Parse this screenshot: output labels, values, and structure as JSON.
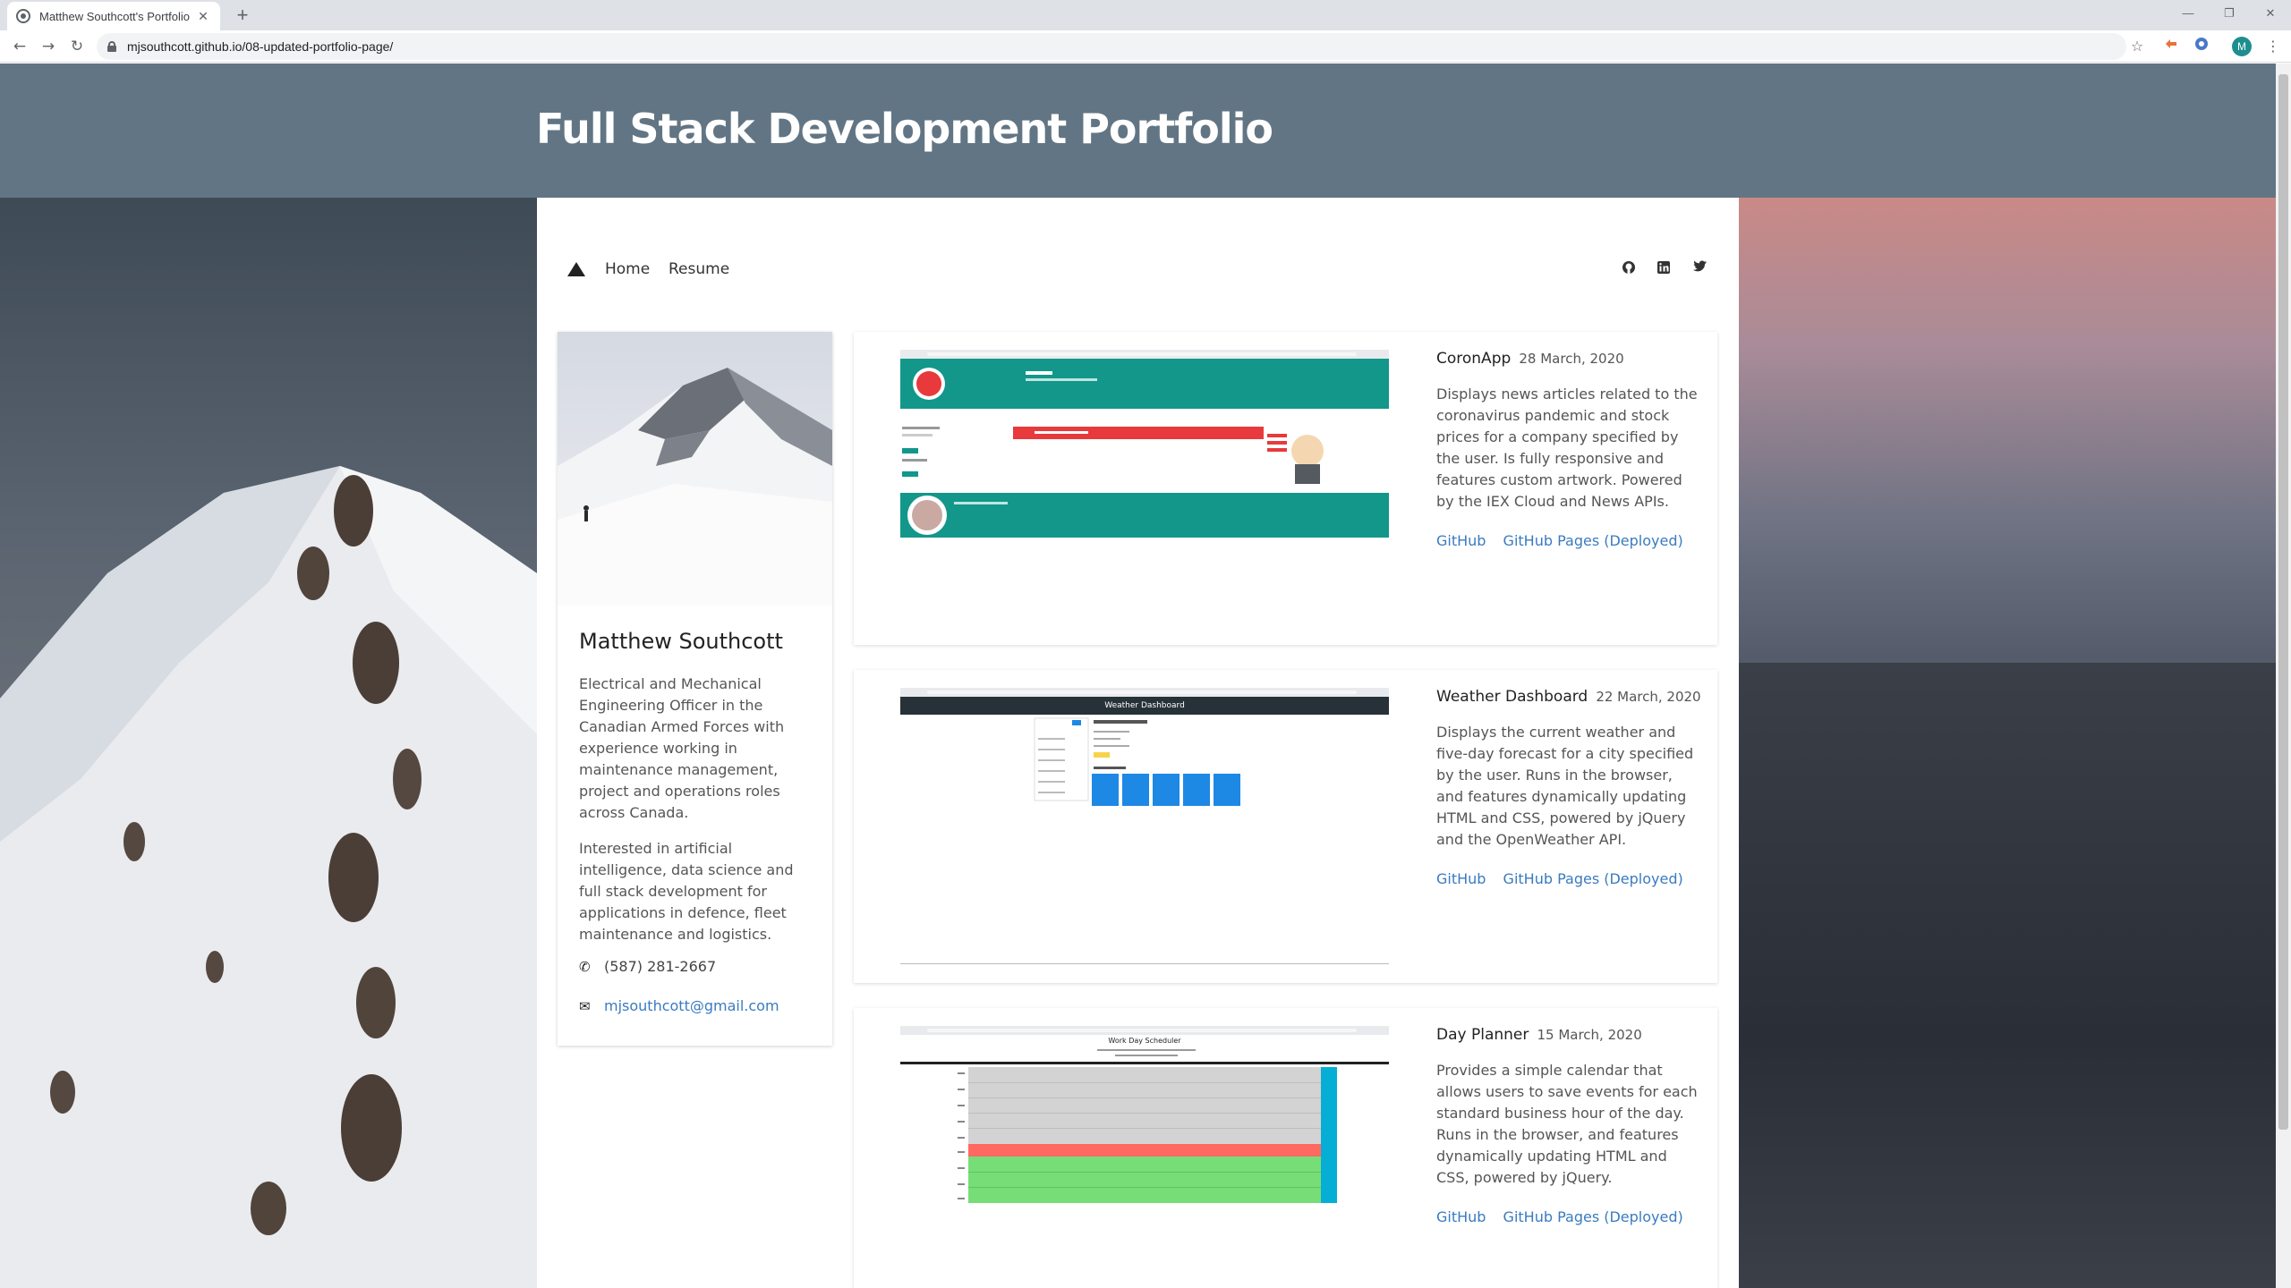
{
  "browser": {
    "tab_title": "Matthew Southcott's Portfolio",
    "tab_close": "✕",
    "new_tab": "+",
    "url": "mjsouthcott.github.io/08-updated-portfolio-page/",
    "back": "←",
    "forward": "→",
    "reload": "↻",
    "bookmark_star": "☆",
    "profile_initial": "M",
    "menu": "⋮",
    "window_minimize": "—",
    "window_restore": "❐",
    "window_close": "✕"
  },
  "site": {
    "title": "Full Stack Development Portfolio"
  },
  "nav": {
    "links": [
      "Home",
      "Resume"
    ],
    "social": [
      "github-icon",
      "linkedin-icon",
      "twitter-icon"
    ]
  },
  "profile": {
    "name": "Matthew Southcott",
    "bio_1": "Electrical and Mechanical Engineering Officer in the Canadian Armed Forces with experience working in maintenance management, project and operations roles across Canada.",
    "bio_2": "Interested in artificial intelligence, data science and full stack development for applications in defence, fleet maintenance and logistics.",
    "phone": "(587) 281-2667",
    "email": "mjsouthcott@gmail.com"
  },
  "projects": [
    {
      "name": "CoronApp",
      "date": "28 March, 2020",
      "description": "Displays news articles related to the coronavirus pandemic and stock prices for a company specified by the user. Is fully responsive and features custom artwork. Powered by the IEX Cloud and News APIs.",
      "link_github": "GitHub",
      "link_pages": "GitHub Pages (Deployed)"
    },
    {
      "name": "Weather Dashboard",
      "date": "22 March, 2020",
      "description": "Displays the current weather and five-day forecast for a city specified by the user. Runs in the browser, and features dynamically updating HTML and CSS, powered by jQuery and the OpenWeather API.",
      "link_github": "GitHub",
      "link_pages": "GitHub Pages (Deployed)",
      "screenshot_header": "Weather Dashboard"
    },
    {
      "name": "Day Planner",
      "date": "15 March, 2020",
      "description": "Provides a simple calendar that allows users to save events for each standard business hour of the day. Runs in the browser, and features dynamically updating HTML and CSS, powered by jQuery.",
      "link_github": "GitHub",
      "link_pages": "GitHub Pages (Deployed)",
      "screenshot_header": "Work Day Scheduler"
    }
  ],
  "colors": {
    "header_bg": "#627584",
    "link": "#3a7bbf",
    "coronapp_teal": "#12978a",
    "coronapp_red": "#e8393c",
    "planner_past": "#d3d3d3",
    "planner_present": "#ff6961",
    "planner_future": "#77dd77",
    "planner_save": "#06aed5"
  }
}
